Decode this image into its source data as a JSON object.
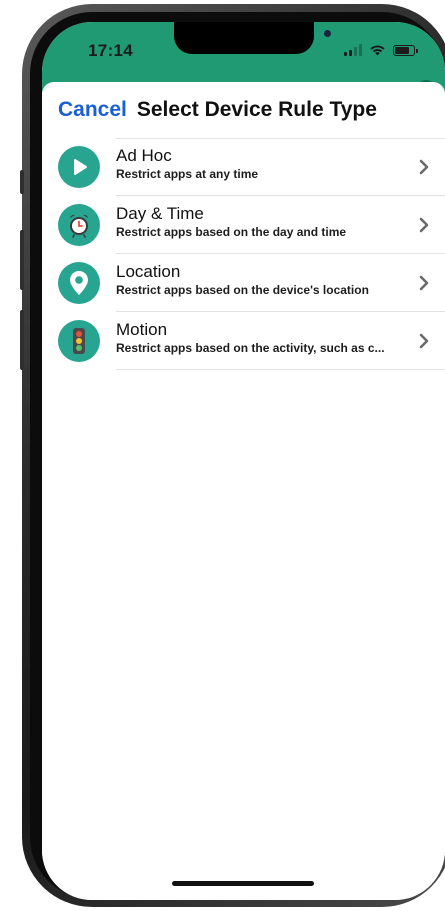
{
  "status_bar": {
    "time": "17:14"
  },
  "header": {
    "cancel_label": "Cancel",
    "title": "Select Device Rule Type"
  },
  "rules": [
    {
      "title": "Ad Hoc",
      "subtitle": "Restrict apps at any time",
      "icon": "play-icon"
    },
    {
      "title": "Day & Time",
      "subtitle": "Restrict apps based on the day and time",
      "icon": "alarm-clock-icon"
    },
    {
      "title": "Location",
      "subtitle": "Restrict apps based on the device's location",
      "icon": "location-pin-icon"
    },
    {
      "title": "Motion",
      "subtitle": "Restrict apps based on the activity, such as c...",
      "icon": "traffic-light-icon"
    }
  ],
  "colors": {
    "accent": "#1a5fd6",
    "icon_background": "#27a590",
    "status_bar_background": "#1f9a73"
  }
}
